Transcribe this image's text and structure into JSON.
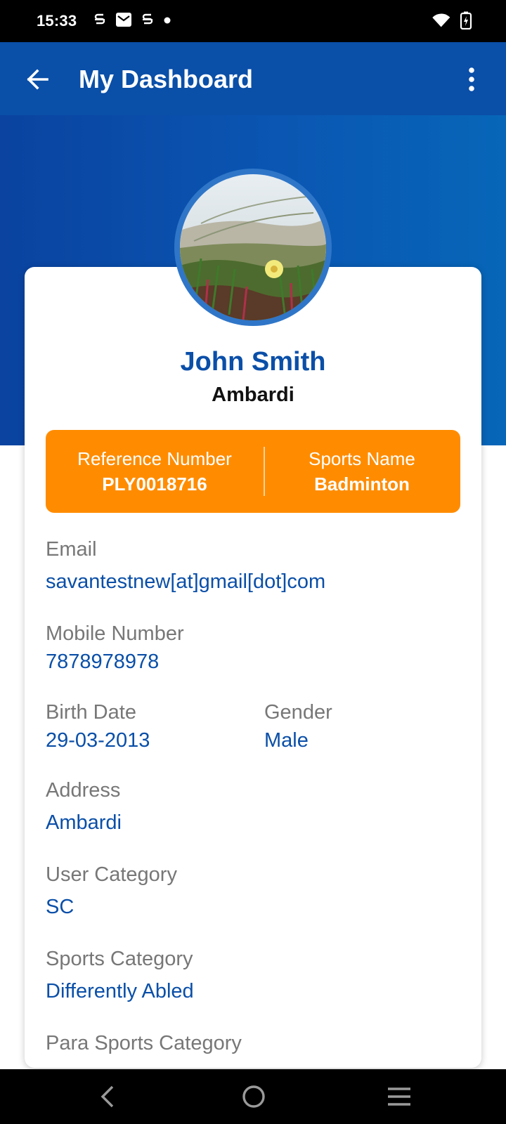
{
  "status_bar": {
    "time": "15:33",
    "icons_left": [
      "s-icon",
      "mail-icon",
      "s-icon",
      "dot-icon"
    ],
    "icons_right": [
      "wifi-icon",
      "battery-charging-icon"
    ]
  },
  "app_bar": {
    "title": "My Dashboard",
    "back_icon": "arrow-left-icon",
    "menu_icon": "more-vert-icon"
  },
  "profile": {
    "name": "John Smith",
    "location": "Ambardi"
  },
  "summary": {
    "reference_label": "Reference Number",
    "reference_value": "PLY0018716",
    "sports_label": "Sports Name",
    "sports_value": "Badminton"
  },
  "fields": {
    "email": {
      "label": "Email",
      "value": "savantestnew[at]gmail[dot]com"
    },
    "mobile": {
      "label": "Mobile Number",
      "value": "7878978978"
    },
    "birth_date": {
      "label": "Birth Date",
      "value": "29-03-2013"
    },
    "gender": {
      "label": "Gender",
      "value": "Male"
    },
    "address": {
      "label": "Address",
      "value": "Ambardi"
    },
    "user_category": {
      "label": "User Category",
      "value": "SC"
    },
    "sports_category": {
      "label": "Sports Category",
      "value": "Differently Abled"
    },
    "para_sports_category": {
      "label": "Para Sports Category",
      "value": ""
    }
  },
  "colors": {
    "primary": "#0a4fa8",
    "accent": "#ff8c00",
    "label": "#777777"
  },
  "nav_bar": {
    "icons": [
      "nav-back-icon",
      "nav-home-icon",
      "nav-recents-icon"
    ]
  }
}
